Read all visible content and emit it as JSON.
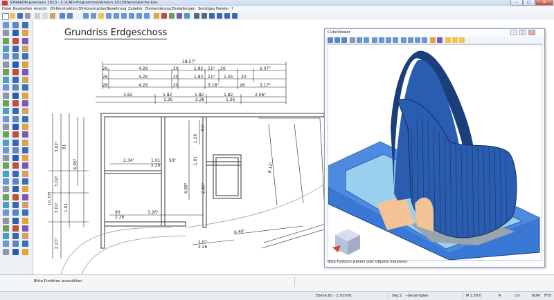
{
  "window": {
    "title": "STRAKON premium 2013  -  C:\\CAD-Programme\\Version 2013\\Demo\\Kirche.kon",
    "controls": [
      "–",
      "□",
      "✕"
    ]
  },
  "menu": [
    "Datei",
    "Bearbeiten",
    "Ansicht",
    "2D-Konstruktion",
    "3D-Konstruktion",
    "Bewehrung",
    "Zubehör",
    "Elementierung",
    "Einstellungen",
    "Sonstiges",
    "Fenster",
    "?"
  ],
  "toolbar": {
    "icons": [
      "new-icon",
      "open-icon",
      "save-icon",
      "print-icon",
      "cut-icon",
      "copy-icon",
      "paste-icon",
      "undo-icon",
      "redo-icon",
      "zoom-in-icon",
      "zoom-out-icon",
      "zoom-window-icon",
      "zoom-all-icon",
      "pan-icon",
      "redraw-icon",
      "layer-icon",
      "snap-icon",
      "grid-icon",
      "measure-icon",
      "settings-icon"
    ],
    "accent": "#2b6cb0"
  },
  "drawing": {
    "title": "Grundriss Erdgeschoss",
    "dimensions": {
      "top_total": "18.57⁵",
      "row1": [
        "26",
        "4.29",
        "20",
        "1.82",
        "11⁵",
        "26",
        "2.07⁵"
      ],
      "row2": [
        "26",
        "4.29",
        "20",
        "1.82",
        "11⁵",
        "1.25",
        "20"
      ],
      "row3": [
        "26",
        "4.29",
        "20",
        "3.18⁵",
        "26",
        "3.17⁵"
      ],
      "row4a": [
        "3.82",
        "1.82",
        "1.82",
        "1.82",
        "2.06⁵"
      ],
      "row4b": [
        "1.26",
        "2.26",
        "1.26"
      ],
      "inner": [
        "2.34⁵",
        "1.01",
        "2.26",
        "93⁵",
        "3.26⁵",
        "90",
        "2.26"
      ],
      "diag": [
        "8.12⁵",
        "6.40⁵",
        "1.01",
        "2.26"
      ],
      "left_vert": [
        "10.37⁵",
        "2.27⁵",
        "3.02⁵",
        "3.02⁵",
        "3.02⁵",
        "6.05⁵",
        "91",
        "1.01"
      ],
      "mid_vert": [
        "4.88⁵",
        "1.26",
        "1.01",
        "61⁵",
        "2.40⁵"
      ]
    }
  },
  "cube_viewer": {
    "title": "CubeViewer",
    "controls": [
      "–",
      "□",
      "✕"
    ],
    "status": "Bitte Funktion wählen oder Objekte markieren",
    "colors": {
      "roof": "#2a5db0",
      "wall": "#1b3f7a",
      "slab": "#3a78d6",
      "floor": "#9ad0ee",
      "wood": "#f2c394"
    }
  },
  "command_line": "Bitte Funktion auswählen",
  "status_bar": {
    "items": [
      "Ebene:91",
      "- 1 Schnitt",
      "Seg:2",
      "- Gesamtplan",
      "M 1:50.0",
      "R",
      "cm",
      "NUM",
      "FHS"
    ]
  }
}
